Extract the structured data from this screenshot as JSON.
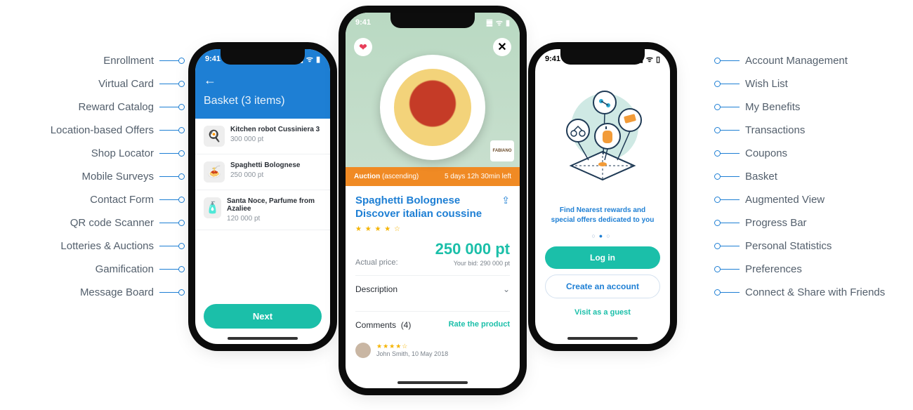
{
  "features_left": [
    "Enrollment",
    "Virtual Card",
    "Reward Catalog",
    "Location-based Offers",
    "Shop Locator",
    "Mobile Surveys",
    "Contact Form",
    "QR code Scanner",
    "Lotteries & Auctions",
    "Gamification",
    "Message Board"
  ],
  "features_right": [
    "Account Management",
    "Wish List",
    "My Benefits",
    "Transactions",
    "Coupons",
    "Basket",
    "Augmented View",
    "Progress Bar",
    "Personal Statistics",
    "Preferences",
    "Connect & Share with Friends"
  ],
  "status_time": "9:41",
  "phone1": {
    "title": "Basket",
    "subtitle": "(3 items)",
    "items": [
      {
        "name": "Kitchen robot Cussiniera 3",
        "points": "300 000 pt",
        "thumb_color": "#d83a3a"
      },
      {
        "name": "Spaghetti Bolognese",
        "points": "250 000 pt",
        "thumb_color": "#e8d49a"
      },
      {
        "name": "Santa Noce, Parfume from Azaliee",
        "points": "120 000 pt",
        "thumb_color": "#e7b7a3"
      }
    ],
    "next": "Next"
  },
  "phone2": {
    "auction_label": "Auction",
    "auction_mode": "(ascending)",
    "time_left": "5 days 12h 30min left",
    "brand_badge": "FABIANO",
    "title_line1": "Spaghetti Bolognese",
    "title_line2": "Discover italian coussine",
    "stars": "★ ★ ★ ★ ☆",
    "actual_label": "Actual price:",
    "actual_price": "250 000 pt",
    "your_bid_label": "Your bid:",
    "your_bid": "290 000 pt",
    "description": "Description",
    "comments_label": "Comments",
    "comments_count": "(4)",
    "rate_link": "Rate the product",
    "comment_author": "John Smith,",
    "comment_date": "10  May 2018"
  },
  "phone3": {
    "tagline": "Find Nearest rewards and special offers dedicated to you",
    "login": "Log in",
    "create": "Create an account",
    "guest": "Visit as a guest"
  }
}
